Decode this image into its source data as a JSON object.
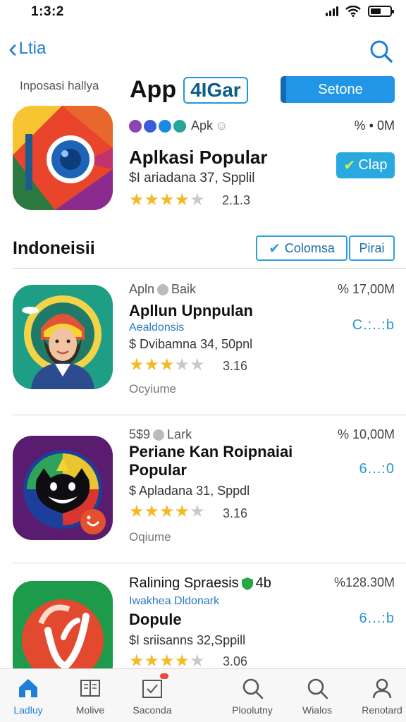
{
  "status": {
    "time": "1:3:2"
  },
  "nav": {
    "back_label": "Ltia"
  },
  "header": {
    "subtitle": "Inposasi hallya",
    "title": "App",
    "badge": "4IGar",
    "button": "Setone"
  },
  "featured": {
    "meta": "Apk",
    "size": "% • 0M",
    "title": "Aplkasi Popular",
    "subtitle": "$I ariadana 37, Spplil",
    "rating": 4.5,
    "rating_label": "2.1.3",
    "button": "Clap"
  },
  "section": {
    "title": "Indoneisii",
    "button1": "Colomsa",
    "button2": "Pirai"
  },
  "apps": [
    {
      "meta": "Apln",
      "meta2": "Baik",
      "size": "% 17,00M",
      "name": "Apllun Upnpulan",
      "developer": "Aealdonsis",
      "subtitle": "$ Dvibamna 34, 50pnl",
      "rating": 3.5,
      "rating_label": "3.16",
      "get": "C.:..:b",
      "note": "Ocyiume"
    },
    {
      "meta": "5$9",
      "meta2": "Lark",
      "size": "% 10,00M",
      "name": "Periane Kan Roipnaiai Popular",
      "developer": "",
      "subtitle": "$ Apladana 31, Sppdl",
      "rating": 4,
      "rating_label": "3.16",
      "get": "6...:0",
      "note": "Oqiume"
    },
    {
      "meta": "Ralining Spraesis",
      "meta2": "4b",
      "size": "%128.30M",
      "name": "Dopule",
      "developer": "Iwakhea Dldonark",
      "subtitle": "$I sriisanns 32,Sppill",
      "rating": 4,
      "rating_label": "3.06",
      "get": "6...:b",
      "note": ""
    }
  ],
  "tabs": [
    {
      "label": "Ladluy",
      "icon": "home-icon",
      "active": true
    },
    {
      "label": "Molive",
      "icon": "news-icon",
      "active": false
    },
    {
      "label": "Saconda",
      "icon": "calendar-icon",
      "active": false
    },
    {
      "label": "Ploolutny",
      "icon": "search-icon",
      "active": false
    },
    {
      "label": "Wialos",
      "icon": "search-icon",
      "active": false
    },
    {
      "label": "Renotard",
      "icon": "profile-icon",
      "active": false
    }
  ],
  "colors": {
    "accent": "#1e7fd6",
    "button": "#2196e6",
    "star": "#f5b928"
  }
}
